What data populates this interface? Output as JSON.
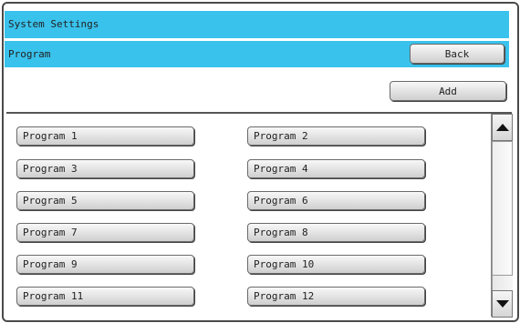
{
  "header": {
    "title": "System Settings"
  },
  "subheader": {
    "title": "Program",
    "back_label": "Back"
  },
  "actions": {
    "add_label": "Add"
  },
  "programs": [
    "Program 1",
    "Program 2",
    "Program 3",
    "Program 4",
    "Program 5",
    "Program 6",
    "Program 7",
    "Program 8",
    "Program 9",
    "Program 10",
    "Program 11",
    "Program 12"
  ],
  "scrollbar": {
    "up_icon": "triangle-up-icon",
    "down_icon": "triangle-down-icon"
  }
}
